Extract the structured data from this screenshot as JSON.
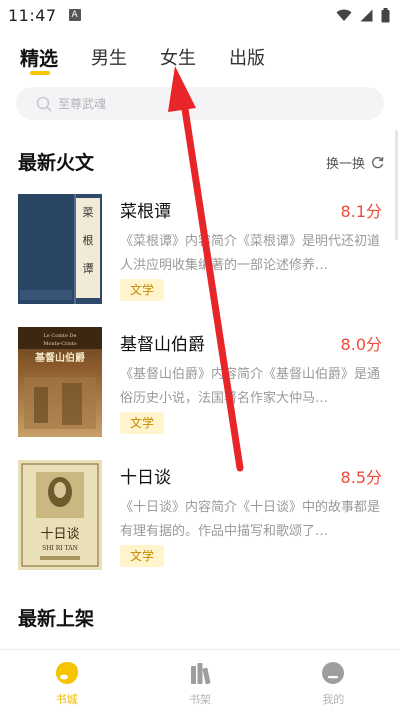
{
  "status_bar": {
    "time": "11:47",
    "notification_badge": "A"
  },
  "tabs": [
    {
      "label": "精选",
      "active": true
    },
    {
      "label": "男生",
      "active": false
    },
    {
      "label": "女生",
      "active": false
    },
    {
      "label": "出版",
      "active": false
    }
  ],
  "search": {
    "placeholder": "至尊武魂"
  },
  "sections": {
    "hot_title": "最新火文",
    "refresh_label": "换一换",
    "new_title": "最新上架"
  },
  "books": [
    {
      "title": "菜根谭",
      "score": "8.1分",
      "description": "《菜根谭》内容简介《菜根谭》是明代还初道人洪应明收集编著的一部论述修养…",
      "tag": "文学",
      "cover_text": "菜 根 谭"
    },
    {
      "title": "基督山伯爵",
      "score": "8.0分",
      "description": "《基督山伯爵》内容简介《基督山伯爵》是通俗历史小说，法国著名作家大仲马…",
      "tag": "文学",
      "cover_text": "基督山伯爵",
      "cover_subtext": "Le Comte De Monte-Cristo"
    },
    {
      "title": "十日谈",
      "score": "8.5分",
      "description": "《十日谈》内容简介《十日谈》中的故事都是有理有据的。作品中描写和歌颂了…",
      "tag": "文学",
      "cover_text": "十日谈",
      "cover_subtext": "SHI RI TAN"
    }
  ],
  "bottom_nav": [
    {
      "label": "书城",
      "icon": "bookstore-icon",
      "active": true
    },
    {
      "label": "书架",
      "icon": "bookshelf-icon",
      "active": false
    },
    {
      "label": "我的",
      "icon": "profile-icon",
      "active": false
    }
  ],
  "colors": {
    "accent": "#f6c400",
    "score": "#f04b3a",
    "tag_bg": "#fff4cc",
    "tag_text": "#c58a00",
    "arrow": "#e8262a"
  }
}
